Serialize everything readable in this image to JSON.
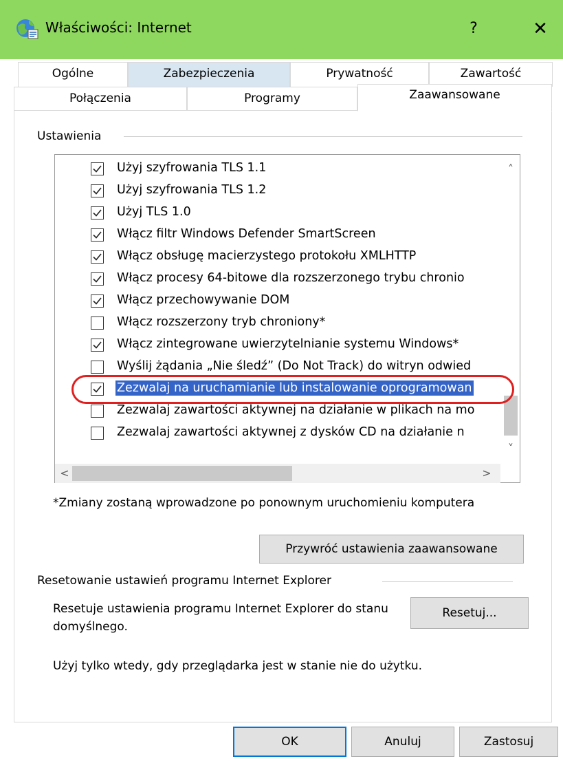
{
  "window": {
    "title": "Właściwości: Internet",
    "help_label": "?",
    "close_label": "✕",
    "titlebar_color": "#8fd85f"
  },
  "tabs_row1": [
    {
      "label": "Ogólne"
    },
    {
      "label": "Zabezpieczenia"
    },
    {
      "label": "Prywatność"
    },
    {
      "label": "Zawartość"
    }
  ],
  "tabs_row2": [
    {
      "label": "Połączenia"
    },
    {
      "label": "Programy"
    },
    {
      "label": "Zaawansowane",
      "active": true
    }
  ],
  "settings": {
    "group_title": "Ustawienia",
    "items": [
      {
        "label": "Użyj szyfrowania TLS 1.1",
        "checked": true
      },
      {
        "label": "Użyj szyfrowania TLS 1.2",
        "checked": true
      },
      {
        "label": "Użyj TLS 1.0",
        "checked": true
      },
      {
        "label": "Włącz filtr Windows Defender SmartScreen",
        "checked": true
      },
      {
        "label": "Włącz obsługę macierzystego protokołu XMLHTTP",
        "checked": true
      },
      {
        "label": "Włącz procesy 64-bitowe dla rozszerzonego trybu chronio",
        "checked": true
      },
      {
        "label": "Włącz przechowywanie DOM",
        "checked": true
      },
      {
        "label": "Włącz rozszerzony tryb chroniony*",
        "checked": false
      },
      {
        "label": "Włącz zintegrowane uwierzytelnianie systemu Windows*",
        "checked": true
      },
      {
        "label": "Wyślij żądania „Nie śledź” (Do Not Track) do witryn odwied",
        "checked": false
      },
      {
        "label": "Zezwalaj na uruchamianie lub instalowanie oprogramowan",
        "checked": true,
        "selected": true
      },
      {
        "label": "Zezwalaj zawartości aktywnej na działanie w plikach na mo",
        "checked": false
      },
      {
        "label": "Zezwalaj zawartości aktywnej z dysków CD na działanie n",
        "checked": false
      }
    ],
    "highlight_color": "#e02020"
  },
  "scroll_arrows": {
    "up": "˄",
    "down": "˅",
    "left": "<",
    "right": ">"
  },
  "restart_note": "*Zmiany zostaną wprowadzone po ponownym uruchomieniu komputera",
  "restore_button": "Przywróć ustawienia zaawansowane",
  "reset_section": {
    "title": "Resetowanie ustawień programu Internet Explorer",
    "description": "Resetuje ustawienia programu Internet Explorer do stanu domyślnego.",
    "button": "Resetuj...",
    "warning": "Użyj tylko wtedy, gdy przeglądarka jest w stanie nie do użytku."
  },
  "footer_buttons": {
    "ok": "OK",
    "cancel": "Anuluj",
    "apply": "Zastosuj"
  }
}
